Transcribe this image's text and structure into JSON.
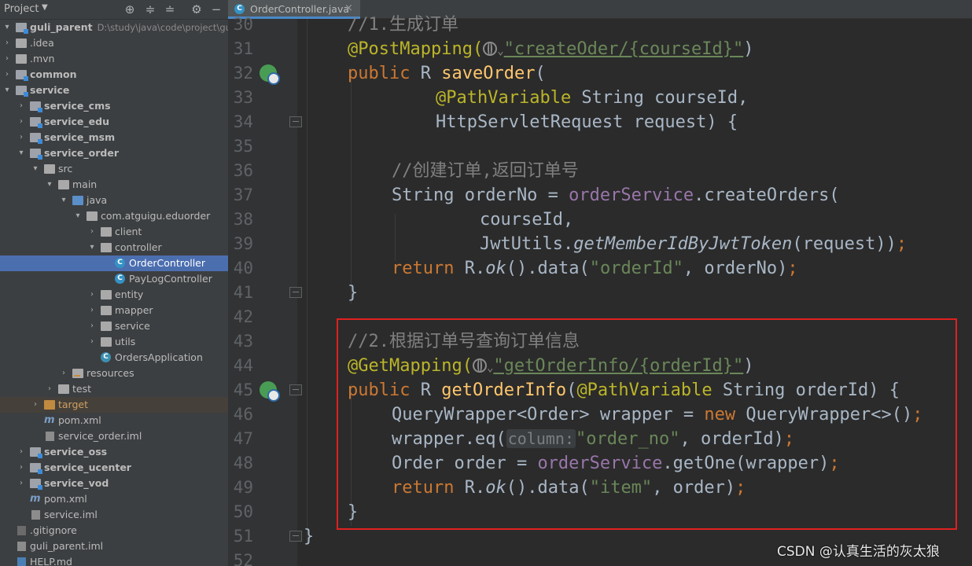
{
  "project_panel": {
    "title": "Project",
    "tree": [
      {
        "label": "guli_parent",
        "path": "D:\\study\\java\\code\\project\\guli_p"
      },
      {
        "label": ".idea"
      },
      {
        "label": ".mvn"
      },
      {
        "label": "common"
      },
      {
        "label": "service"
      },
      {
        "label": "service_cms"
      },
      {
        "label": "service_edu"
      },
      {
        "label": "service_msm"
      },
      {
        "label": "service_order"
      },
      {
        "label": "src"
      },
      {
        "label": "main"
      },
      {
        "label": "java"
      },
      {
        "label": "com.atguigu.eduorder"
      },
      {
        "label": "client"
      },
      {
        "label": "controller"
      },
      {
        "label": "OrderController"
      },
      {
        "label": "PayLogController"
      },
      {
        "label": "entity"
      },
      {
        "label": "mapper"
      },
      {
        "label": "service"
      },
      {
        "label": "utils"
      },
      {
        "label": "OrdersApplication"
      },
      {
        "label": "resources"
      },
      {
        "label": "test"
      },
      {
        "label": "target"
      },
      {
        "label": "pom.xml"
      },
      {
        "label": "service_order.iml"
      },
      {
        "label": "service_oss"
      },
      {
        "label": "service_ucenter"
      },
      {
        "label": "service_vod"
      },
      {
        "label": "pom.xml"
      },
      {
        "label": "service.iml"
      },
      {
        "label": ".gitignore"
      },
      {
        "label": "guli_parent.iml"
      },
      {
        "label": "HELP.md"
      }
    ]
  },
  "editor": {
    "tab": {
      "label": "OrderController.java",
      "close": "×"
    },
    "line_numbers": [
      "30",
      "31",
      "32",
      "33",
      "34",
      "35",
      "36",
      "37",
      "38",
      "39",
      "40",
      "41",
      "42",
      "43",
      "44",
      "45",
      "46",
      "47",
      "48",
      "49",
      "50",
      "51",
      "52"
    ],
    "code": {
      "l30": "//1.生成订单",
      "l31_ann": "@PostMapping(",
      "l31_str": "\"createOder/{courseId}\"",
      "l31_end": ")",
      "l32_kw": "public",
      "l32_type": " R ",
      "l32_fn": "saveOrder",
      "l32_end": "(",
      "l33_ann": "@PathVariable",
      "l33_rest": " String courseId,",
      "l34": "HttpServletRequest request) {",
      "l36": "//创建订单,返回订单号",
      "l37_a": "String orderNo = ",
      "l37_fld": "orderService",
      "l37_b": ".createOrders(",
      "l38": "courseId,",
      "l39_a": "JwtUtils.",
      "l39_it": "getMemberIdByJwtToken",
      "l39_b": "(request))",
      "l39_semi": ";",
      "l40_kw": "return",
      "l40_a": " R.",
      "l40_it": "ok",
      "l40_b": "().data(",
      "l40_str": "\"orderId\"",
      "l40_c": ", orderNo)",
      "l40_semi": ";",
      "l41": "}",
      "l43": "//2.根据订单号查询订单信息",
      "l44_ann": "@GetMapping(",
      "l44_str": "\"getOrderInfo/{orderId}\"",
      "l44_end": ")",
      "l45_kw": "public",
      "l45_type": " R ",
      "l45_fn": "getOrderInfo",
      "l45_a": "(",
      "l45_ann": "@PathVariable",
      "l45_b": " String orderId) {",
      "l46_a": "QueryWrapper<Order> wrapper = ",
      "l46_kw": "new",
      "l46_b": " QueryWrapper<>()",
      "l46_semi": ";",
      "l47_a": "wrapper.eq(",
      "l47_hint": "column:",
      "l47_str": "\"order_no\"",
      "l47_b": ", orderId)",
      "l47_semi": ";",
      "l48_a": "Order order = ",
      "l48_fld": "orderService",
      "l48_b": ".getOne(wrapper)",
      "l48_semi": ";",
      "l49_kw": "return",
      "l49_a": " R.",
      "l49_it": "ok",
      "l49_b": "().data(",
      "l49_str": "\"item\"",
      "l49_c": ", order)",
      "l49_semi": ";",
      "l50": "}",
      "l51": "}"
    }
  },
  "watermark": "CSDN @认真生活的灰太狼",
  "colors": {
    "keyword": "#cc7832",
    "annotation": "#bbb529",
    "string": "#6a8759",
    "comment": "#808080",
    "method": "#ffc66d",
    "field": "#9876aa",
    "selection": "#4b6eaf",
    "highlight_box": "#e02020"
  }
}
